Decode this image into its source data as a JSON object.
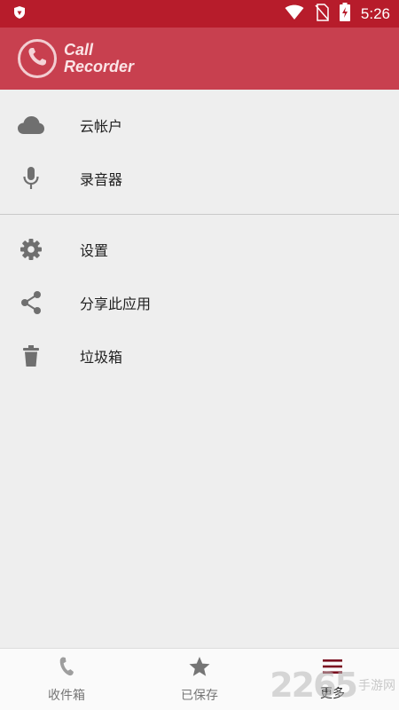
{
  "status_bar": {
    "time": "5:26",
    "icons": [
      "shield-icon",
      "wifi-icon",
      "no-sim-icon",
      "battery-charging-icon"
    ]
  },
  "app_bar": {
    "logo_line1": "Call",
    "logo_line2": "Recorder",
    "logo_icon": "phone-handset-icon"
  },
  "menu": {
    "group1": [
      {
        "label": "云帐户",
        "icon": "cloud-icon"
      },
      {
        "label": "录音器",
        "icon": "microphone-icon"
      }
    ],
    "group2": [
      {
        "label": "设置",
        "icon": "gear-icon"
      },
      {
        "label": "分享此应用",
        "icon": "share-icon"
      },
      {
        "label": "垃圾箱",
        "icon": "trash-icon"
      }
    ]
  },
  "bottom_nav": [
    {
      "label": "收件箱",
      "icon": "phone-handset-icon",
      "active": false
    },
    {
      "label": "已保存",
      "icon": "star-icon",
      "active": false
    },
    {
      "label": "更多",
      "icon": "menu-icon",
      "active": true
    }
  ],
  "watermark": {
    "number": "2265",
    "text": "手游网"
  },
  "colors": {
    "status_bar": "#b71c2b",
    "app_bar": "#c8404f",
    "background": "#eeeeee",
    "icon_gray": "#6f6f6f",
    "active_nav": "#7a1020"
  }
}
